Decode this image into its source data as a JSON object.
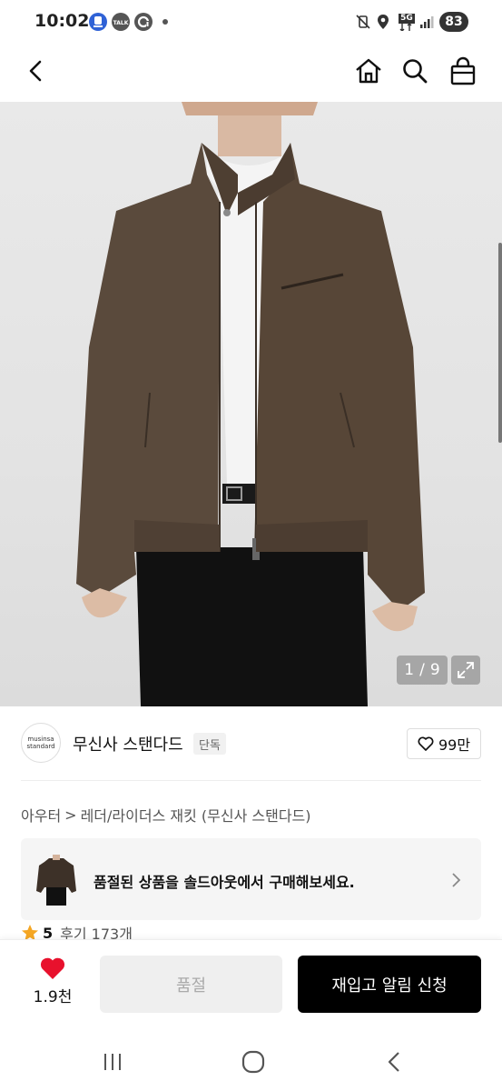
{
  "status_bar": {
    "time": "10:02",
    "talk_badge": "TALK",
    "network": "5G",
    "battery": "83"
  },
  "header": {
    "back_icon": "chevron-left-icon",
    "home_icon": "home-icon",
    "search_icon": "search-icon",
    "cart_icon": "shopping-bag-icon"
  },
  "gallery": {
    "current": "1",
    "separator": "/",
    "total": "9"
  },
  "brand": {
    "logo_line1": "musinsa",
    "logo_line2": "standard",
    "name": "무신사 스탠다드",
    "badge": "단독",
    "like_count": "99만"
  },
  "breadcrumb": {
    "category1": "아우터",
    "separator": ">",
    "category2": "레더/라이더스 재킷 (무신사 스탠다드)"
  },
  "soldout_banner": {
    "text": "품절된 상품을 솔드아웃에서 구매해보세요."
  },
  "rating": {
    "score": "5",
    "review_label": "후기 173개"
  },
  "purchase_bar": {
    "wish_count": "1.9천",
    "soldout_label": "품절",
    "restock_label": "재입고 알림 신청"
  },
  "colors": {
    "accent": "#000000",
    "heart": "#e8112d",
    "star": "#f5a623"
  }
}
